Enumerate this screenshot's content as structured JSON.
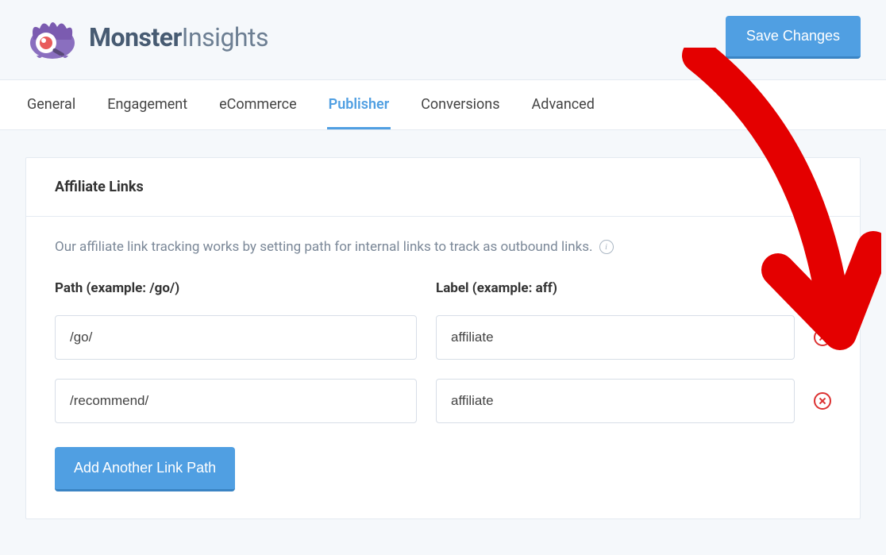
{
  "brand": {
    "strong": "Monster",
    "light": "Insights"
  },
  "header": {
    "save_label": "Save Changes"
  },
  "tabs": [
    {
      "label": "General",
      "active": false
    },
    {
      "label": "Engagement",
      "active": false
    },
    {
      "label": "eCommerce",
      "active": false
    },
    {
      "label": "Publisher",
      "active": true
    },
    {
      "label": "Conversions",
      "active": false
    },
    {
      "label": "Advanced",
      "active": false
    }
  ],
  "panel": {
    "title": "Affiliate Links",
    "help_text": "Our affiliate link tracking works by setting path for internal links to track as outbound links.",
    "col_path_head": "Path (example: /go/)",
    "col_label_head": "Label (example: aff)",
    "rows": [
      {
        "path": "/go/",
        "label": "affiliate"
      },
      {
        "path": "/recommend/",
        "label": "affiliate"
      }
    ],
    "add_button_label": "Add Another Link Path"
  }
}
